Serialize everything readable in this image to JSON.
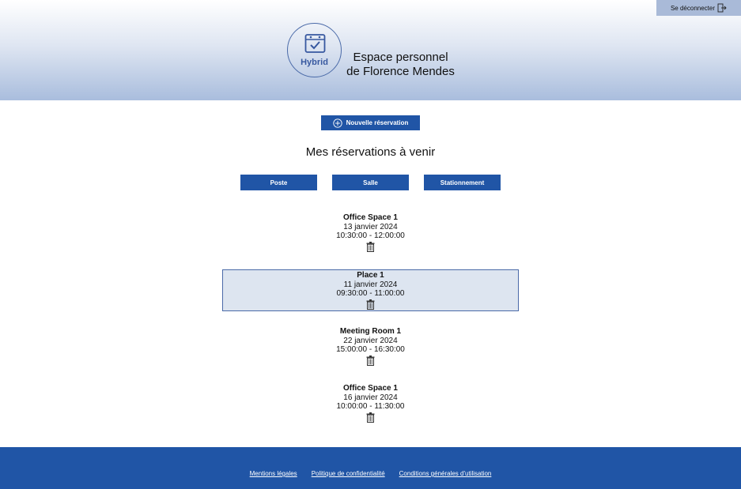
{
  "header": {
    "logout_label": "Se déconnecter",
    "logo_text": "Hybrid",
    "title_line1": "Espace personnel",
    "title_line2": "de Florence Mendes"
  },
  "actions": {
    "new_reservation_label": "Nouvelle réservation"
  },
  "section": {
    "title": "Mes réservations à venir"
  },
  "filters": [
    {
      "label": "Poste"
    },
    {
      "label": "Salle"
    },
    {
      "label": "Stationnement"
    }
  ],
  "reservations": [
    {
      "name": "Office Space 1",
      "date": "13 janvier 2024",
      "time": "10:30:00 - 12:00:00",
      "selected": false
    },
    {
      "name": "Place 1",
      "date": "11 janvier 2024",
      "time": "09:30:00 - 11:00:00",
      "selected": true
    },
    {
      "name": "Meeting Room 1",
      "date": "22 janvier 2024",
      "time": "15:00:00 - 16:30:00",
      "selected": false
    },
    {
      "name": "Office Space 1",
      "date": "16 janvier 2024",
      "time": "10:00:00 - 11:30:00",
      "selected": false
    }
  ],
  "footer": {
    "links": [
      {
        "label": "Mentions légales"
      },
      {
        "label": "Politique de confidentialité"
      },
      {
        "label": "Conditions générales d'utilisation"
      }
    ]
  },
  "colors": {
    "primary": "#2055a6",
    "header_gradient_end": "#a9bddd",
    "selected_bg": "#dde5f0",
    "logo_accent": "#3758a0"
  },
  "icons": {
    "logout": "logout-arrow-icon",
    "logo": "calendar-check-icon",
    "add": "plus-circle-icon",
    "delete": "trash-icon"
  }
}
